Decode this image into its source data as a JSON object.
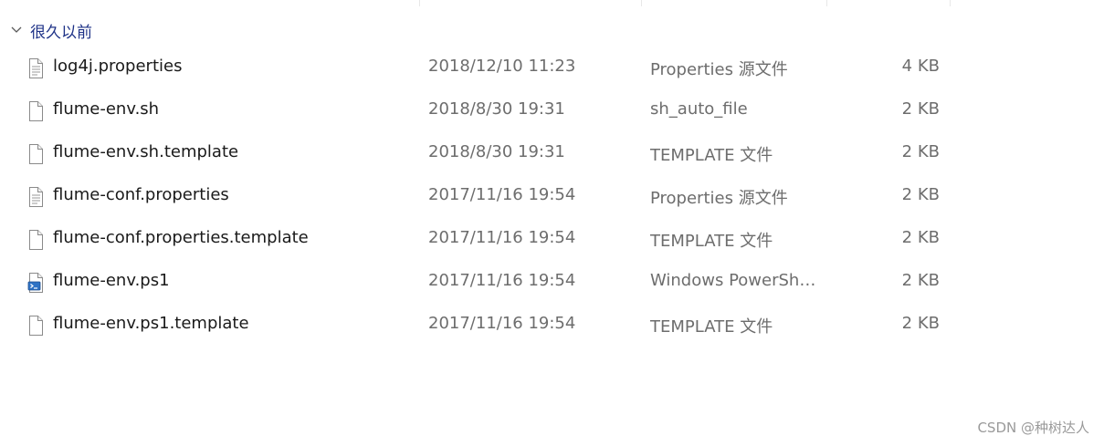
{
  "group": {
    "label": "很久以前",
    "icon": "chevron-down-icon"
  },
  "files": [
    {
      "name": "log4j.properties",
      "date": "2018/12/10 11:23",
      "type": "Properties 源文件",
      "size": "4 KB",
      "icon": "text-document-icon"
    },
    {
      "name": "flume-env.sh",
      "date": "2018/8/30 19:31",
      "type": "sh_auto_file",
      "size": "2 KB",
      "icon": "blank-file-icon"
    },
    {
      "name": "flume-env.sh.template",
      "date": "2018/8/30 19:31",
      "type": "TEMPLATE 文件",
      "size": "2 KB",
      "icon": "blank-file-icon"
    },
    {
      "name": "flume-conf.properties",
      "date": "2017/11/16 19:54",
      "type": "Properties 源文件",
      "size": "2 KB",
      "icon": "text-document-icon"
    },
    {
      "name": "flume-conf.properties.template",
      "date": "2017/11/16 19:54",
      "type": "TEMPLATE 文件",
      "size": "2 KB",
      "icon": "blank-file-icon"
    },
    {
      "name": "flume-env.ps1",
      "date": "2017/11/16 19:54",
      "type": "Windows PowerShe...",
      "size": "2 KB",
      "icon": "powershell-script-icon"
    },
    {
      "name": "flume-env.ps1.template",
      "date": "2017/11/16 19:54",
      "type": "TEMPLATE 文件",
      "size": "2 KB",
      "icon": "blank-file-icon"
    }
  ],
  "watermark": "CSDN @种树达人",
  "colors": {
    "group_label": "#1e3287",
    "name_text": "#1a1a1a",
    "detail_text": "#6d6d6d"
  }
}
